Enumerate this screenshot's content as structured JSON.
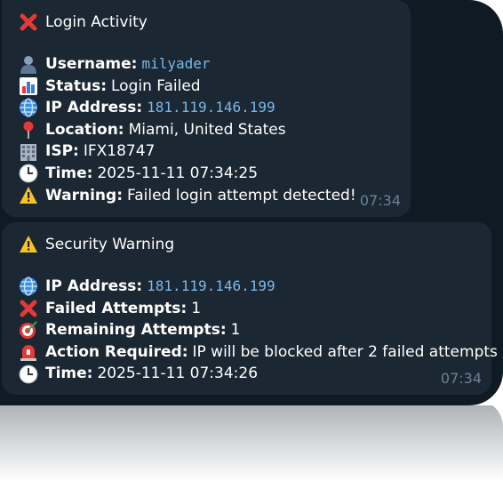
{
  "messages": [
    {
      "title": "Login Activity",
      "title_icon": "cross-mark-icon",
      "rows": [
        {
          "icon": "user-icon",
          "label": "Username:",
          "value": "milyader",
          "mono": true
        },
        {
          "icon": "chart-icon",
          "label": "Status:",
          "value": "Login Failed"
        },
        {
          "icon": "globe-icon",
          "label": "IP Address:",
          "value": "181.119.146.199",
          "mono": true
        },
        {
          "icon": "pin-icon",
          "label": "Location:",
          "value": "Miami, United States"
        },
        {
          "icon": "building-icon",
          "label": "ISP:",
          "value": "IFX18747"
        },
        {
          "icon": "clock-icon",
          "label": "Time:",
          "value": "2025-11-11 07:34:25"
        },
        {
          "icon": "warning-icon",
          "label": "Warning:",
          "value": "Failed login attempt detected!"
        }
      ],
      "time": "07:34"
    },
    {
      "title": "Security Warning",
      "title_icon": "warning-icon",
      "rows": [
        {
          "icon": "globe-icon",
          "label": "IP Address:",
          "value": "181.119.146.199",
          "mono": true
        },
        {
          "icon": "cross-mark-icon",
          "label": "Failed Attempts:",
          "value": "1"
        },
        {
          "icon": "target-icon",
          "label": "Remaining Attempts:",
          "value": "1"
        },
        {
          "icon": "siren-icon",
          "label": "Action Required:",
          "value": "IP will be blocked after 2 failed attempts"
        },
        {
          "icon": "clock-icon",
          "label": "Time:",
          "value": "2025-11-11 07:34:26"
        }
      ],
      "time": "07:34"
    }
  ],
  "colors": {
    "background": "#0f1a24",
    "bubble": "#1b2733",
    "text": "#ffffff",
    "link": "#7cb8e8",
    "timestamp": "#6d8294",
    "warning": "#f7c325",
    "cross": "#e53935"
  }
}
